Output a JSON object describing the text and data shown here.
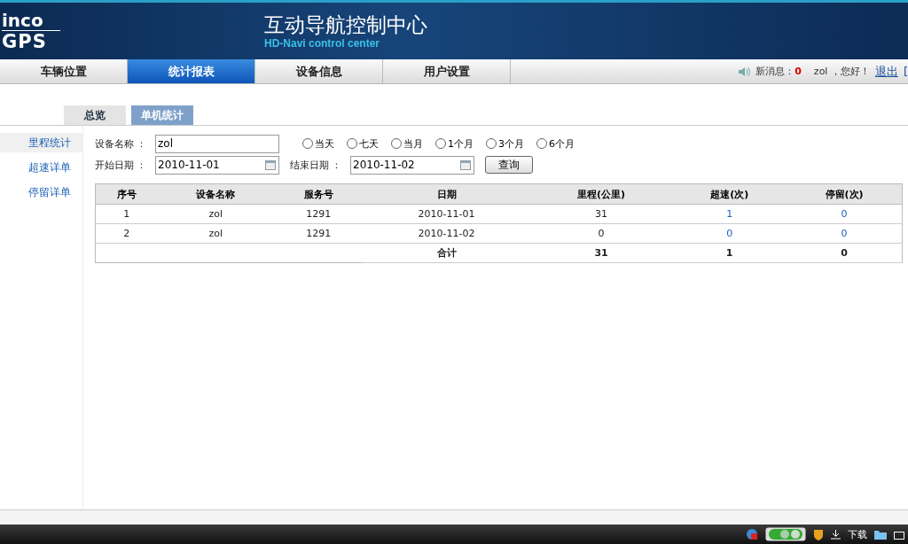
{
  "header": {
    "logo_top": "inco",
    "logo_bottom": "GPS",
    "title": "互动导航控制中心",
    "subtitle": "HD-Navi control center"
  },
  "nav": [
    {
      "label": "车辆位置",
      "selected": false
    },
    {
      "label": "统计报表",
      "selected": true
    },
    {
      "label": "设备信息",
      "selected": false
    },
    {
      "label": "用户设置",
      "selected": false
    }
  ],
  "user_bar": {
    "messages_label": "新消息：",
    "messages_count": "0",
    "greeting": "zol ，您好！",
    "logout": "退出",
    "cut_link": "["
  },
  "sub_tabs": [
    {
      "label": "总览",
      "selected": false
    },
    {
      "label": "单机统计",
      "selected": true
    }
  ],
  "side_menu": [
    {
      "label": "里程统计",
      "selected": true
    },
    {
      "label": "超速详单",
      "selected": false
    },
    {
      "label": "停留详单",
      "selected": false
    }
  ],
  "form": {
    "device_label": "设备名称 ：",
    "device_value": "zol",
    "start_label": "开始日期 ：",
    "start_value": "2010-11-01",
    "end_label": "结束日期 ：",
    "end_value": "2010-11-02",
    "query_button": "查询",
    "ranges": [
      {
        "label": "当天",
        "selected": false
      },
      {
        "label": "七天",
        "selected": false
      },
      {
        "label": "当月",
        "selected": false
      },
      {
        "label": "1个月",
        "selected": false
      },
      {
        "label": "3个月",
        "selected": false
      },
      {
        "label": "6个月",
        "selected": false
      }
    ]
  },
  "table": {
    "columns": [
      {
        "label": "序号",
        "kind": "text"
      },
      {
        "label": "设备名称",
        "kind": "text"
      },
      {
        "label": "服务号",
        "kind": "text"
      },
      {
        "label": "日期",
        "kind": "text"
      },
      {
        "label": "里程(公里)",
        "kind": "text"
      },
      {
        "label": "超速(次)",
        "kind": "link"
      },
      {
        "label": "停留(次)",
        "kind": "link"
      }
    ],
    "rows": [
      [
        "1",
        "zol",
        "1291",
        "2010-11-01",
        "31",
        "1",
        "0"
      ],
      [
        "2",
        "zol",
        "1291",
        "2010-11-02",
        "0",
        "0",
        "0"
      ]
    ],
    "total": {
      "label": "合计",
      "mileage": "31",
      "speeding": "1",
      "stops": "0"
    }
  },
  "status_bar": {
    "download": "下载"
  }
}
